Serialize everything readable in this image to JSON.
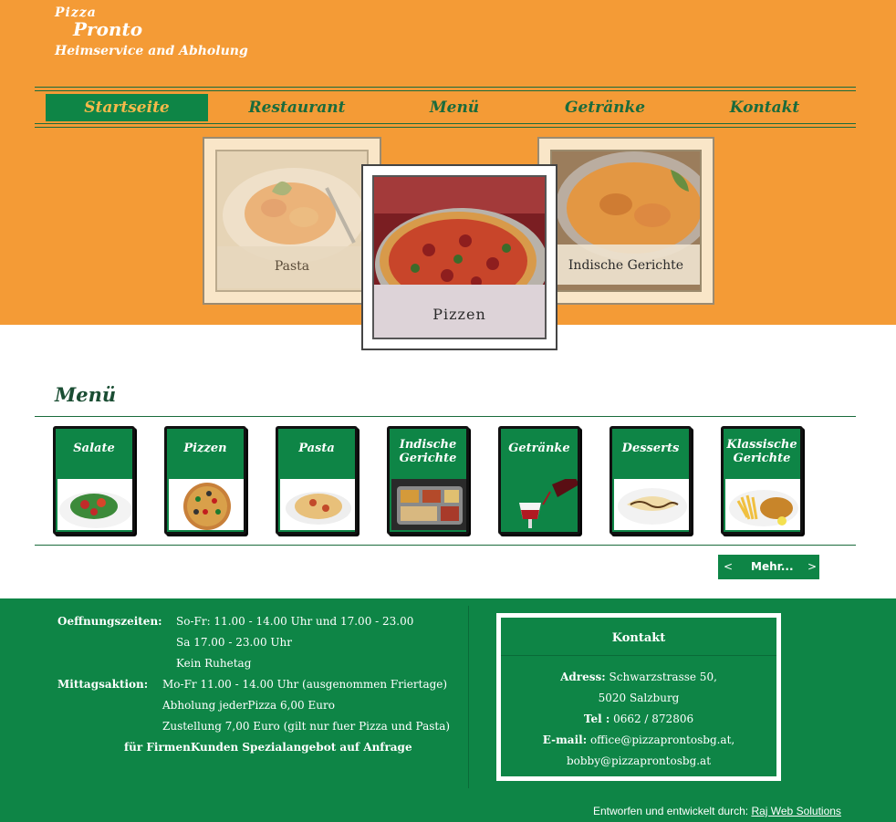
{
  "logo": {
    "line1": "Pizza",
    "line2": "Pronto",
    "line3": "Heimservice and Abholung"
  },
  "nav": {
    "items": [
      "Startseite",
      "Restaurant",
      "Menü",
      "Getränke",
      "Kontakt"
    ],
    "active": "Startseite"
  },
  "slider": {
    "left": "Pasta",
    "center": "Pizzen",
    "right": "Indische Gerichte"
  },
  "menu": {
    "heading": "Menü",
    "cards": [
      "Salate",
      "Pizzen",
      "Pasta",
      "Indische Gerichte",
      "Getränke",
      "Desserts",
      "Klassische Gerichte"
    ],
    "pager": {
      "prev": "<",
      "label": "Mehr...",
      "next": ">"
    }
  },
  "footer": {
    "hours_label": "Oeffnungszeiten:",
    "hours": [
      "So-Fr: 11.00 - 14.00 Uhr und 17.00 - 23.00",
      "Sa 17.00 - 23.00 Uhr",
      "Kein Ruhetag"
    ],
    "lunch_label": "Mittagsaktion:",
    "lunch": [
      "Mo-Fr 11.00 - 14.00 Uhr (ausgenommen Friertage)",
      "Abholung jederPizza 6,00 Euro",
      "Zustellung 7,00 Euro (gilt nur fuer Pizza und Pasta)"
    ],
    "special": "für FirmenKunden Spezialangebot auf Anfrage",
    "contact": {
      "title": "Kontakt",
      "address_label": "Adress:",
      "address_line1": "Schwarzstrasse 50,",
      "address_line2": "5020 Salzburg",
      "tel_label": "Tel :",
      "tel": "0662 / 872806",
      "email_label": "E-mail:",
      "email1": "office@pizzaprontosbg.at,",
      "email2": "bobby@pizzaprontosbg.at"
    },
    "credit_prefix": "Entworfen und entwickelt durch:",
    "credit_link": "Raj Web Solutions"
  },
  "colors": {
    "orange": "#f49b36",
    "green": "#0e8546",
    "dark_green": "#1a6b3c"
  }
}
